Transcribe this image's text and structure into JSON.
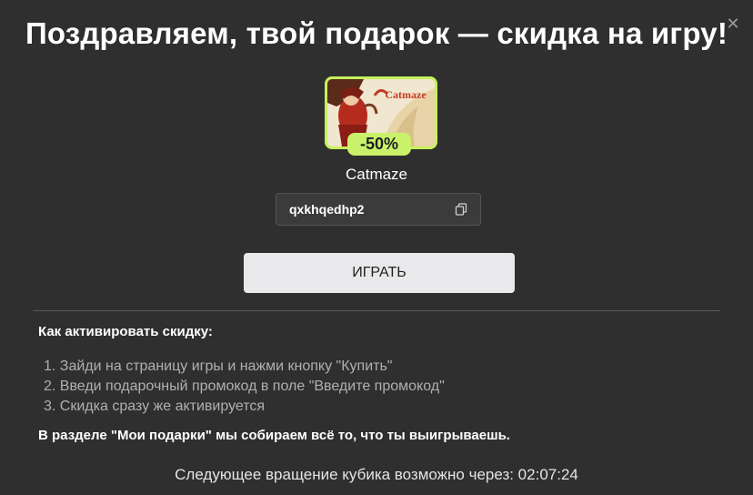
{
  "dialog": {
    "close_symbol": "✕",
    "title": "Поздравляем, твой подарок — скидка на игру!"
  },
  "game": {
    "name": "Catmaze",
    "discount_label": "-50%",
    "thumbnail_logo_text": "Catmaze"
  },
  "promo": {
    "code": "qxkhqedhp2",
    "copy_icon": "copy-icon"
  },
  "actions": {
    "play_label": "ИГРАТЬ"
  },
  "instructions": {
    "heading": "Как активировать скидку:",
    "steps": [
      "1. Зайди на страницу игры и нажми кнопку \"Купить\"",
      "2. Введи подарочный промокод в поле \"Введите промокод\"",
      "3. Скидка сразу же активируется"
    ],
    "gifts_note": "В разделе \"Мои подарки\" мы собираем всё то, что ты выигрываешь."
  },
  "footer": {
    "timer_text": "Следующее вращение кубика возможно через: 02:07:24"
  },
  "colors": {
    "background": "#2f2f2f",
    "accent_green": "#c9f26a",
    "button_bg": "#e9e9eb"
  }
}
